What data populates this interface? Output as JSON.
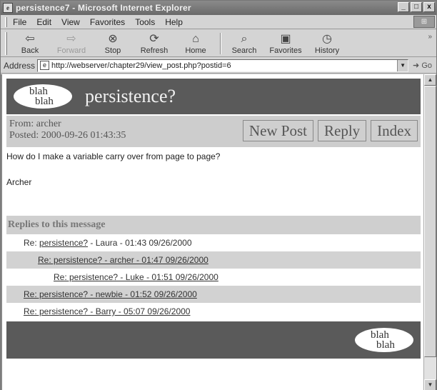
{
  "window": {
    "title": "persistence7 - Microsoft Internet Explorer",
    "controls": [
      "_",
      "□",
      "x"
    ]
  },
  "menu": [
    "File",
    "Edit",
    "View",
    "Favorites",
    "Tools",
    "Help"
  ],
  "toolbar": {
    "back": "Back",
    "forward": "Forward",
    "stop": "Stop",
    "refresh": "Refresh",
    "home": "Home",
    "search": "Search",
    "favorites": "Favorites",
    "history": "History"
  },
  "address": {
    "label": "Address",
    "url": "http://webserver/chapter29/view_post.php?postid=6",
    "go": "Go"
  },
  "page": {
    "logo_line1": "blah",
    "logo_line2": "blah",
    "post_title": "persistence?",
    "from": "From: archer",
    "posted": "Posted: 2000-09-26 01:43:35",
    "buttons": {
      "new_post": "New Post",
      "reply": "Reply",
      "index": "Index"
    },
    "body": "How do I make a variable carry over from page to page?",
    "signature": "Archer",
    "replies_heading": "Replies to this message",
    "replies": [
      {
        "prefix": "Re: ",
        "link": "persistence?",
        "meta": " - Laura - 01:43 09/26/2000"
      },
      {
        "prefix": "",
        "link": "Re: persistence? - archer - 01:47 09/26/2000",
        "meta": ""
      },
      {
        "prefix": "",
        "link": "Re: persistence? - Luke - 01:51 09/26/2000",
        "meta": ""
      },
      {
        "prefix": "",
        "link": "Re: persistence? - newbie - 01:52 09/26/2000",
        "meta": ""
      },
      {
        "prefix": "",
        "link": "Re: persistence? - Barry - 05:07 09/26/2000",
        "meta": ""
      }
    ],
    "footer_logo_line1": "blah",
    "footer_logo_line2": "blah"
  },
  "icons": {
    "app": "ie-page-icon",
    "back": "back-arrow-icon",
    "forward": "forward-arrow-icon",
    "stop": "stop-icon",
    "refresh": "refresh-icon",
    "home": "home-icon",
    "search": "search-icon",
    "favorites": "favorites-icon",
    "history": "history-icon"
  },
  "colors": {
    "banner": "#5a5a5a",
    "bar": "#cdcdcd",
    "content_bg": "#ffffff"
  }
}
